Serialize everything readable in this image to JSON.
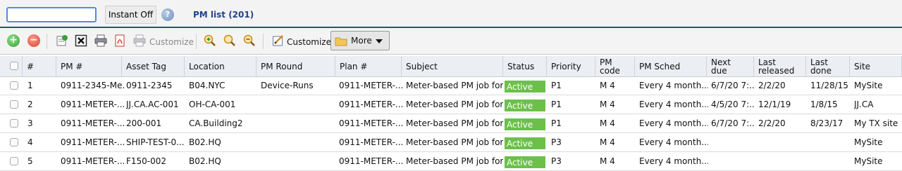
{
  "search": {
    "value": "",
    "placeholder": ""
  },
  "instant_toggle": "Instant Off",
  "help_icon": "?",
  "list_title": "PM list (201)",
  "toolbar": {
    "customize_disabled_label": "Customize",
    "customize_label": "Customize",
    "more_label": "More"
  },
  "table": {
    "headers": {
      "num": "#",
      "pm": "PM #",
      "asset": "Asset Tag",
      "location": "Location",
      "round": "PM Round",
      "plan": "Plan #",
      "subject": "Subject",
      "status": "Status",
      "priority": "Priority",
      "pmcode": "PM code",
      "sched": "PM Sched",
      "nextdue": "Next due",
      "lastrel": "Last released",
      "lastdone": "Last done",
      "site": "Site"
    },
    "rows": [
      {
        "num": "1",
        "pm": "0911-2345-Me...",
        "asset": "0911-2345",
        "location": "B04.NYC",
        "round": "Device-Runs",
        "plan": "0911-METER-...",
        "subject": "Meter-based PM job for...",
        "status": "Active",
        "priority": "P1",
        "pmcode": "M 4",
        "sched": "Every 4 month...",
        "nextdue": "6/7/20 7:...",
        "lastrel": "2/2/20",
        "lastdone": "11/28/15",
        "site": "MySite"
      },
      {
        "num": "2",
        "pm": "0911-METER-...",
        "asset": "JJ.CA.AC-001",
        "location": "OH-CA-001",
        "round": "",
        "plan": "0911-METER-...",
        "subject": "Meter-based PM job for...",
        "status": "Active",
        "priority": "P1",
        "pmcode": "M 4",
        "sched": "Every 4 month...",
        "nextdue": "4/5/20 7:...",
        "lastrel": "12/1/19",
        "lastdone": "1/8/15",
        "site": "JJ.CA"
      },
      {
        "num": "3",
        "pm": "0911-METER-...",
        "asset": "200-001",
        "location": "CA.Building2",
        "round": "",
        "plan": "0911-METER-...",
        "subject": "Meter-based PM job for...",
        "status": "Active",
        "priority": "P1",
        "pmcode": "M 4",
        "sched": "Every 4 month...",
        "nextdue": "6/7/20 7:...",
        "lastrel": "2/2/20",
        "lastdone": "8/23/17",
        "site": "My TX site"
      },
      {
        "num": "4",
        "pm": "0911-METER-...",
        "asset": "SHIP-TEST-0...",
        "location": "B02.HQ",
        "round": "",
        "plan": "0911-METER-...",
        "subject": "Meter-based PM job for...",
        "status": "Active",
        "priority": "P3",
        "pmcode": "M 4",
        "sched": "Every 4 month...",
        "nextdue": "",
        "lastrel": "",
        "lastdone": "",
        "site": "MySite"
      },
      {
        "num": "5",
        "pm": "0911-METER-...",
        "asset": "F150-002",
        "location": "B02.HQ",
        "round": "",
        "plan": "0911-METER-...",
        "subject": "Meter-based PM job for...",
        "status": "Active",
        "priority": "P3",
        "pmcode": "M 4",
        "sched": "Every 4 month...",
        "nextdue": "",
        "lastrel": "",
        "lastdone": "",
        "site": "MySite"
      }
    ]
  },
  "colors": {
    "status_active": "#6cc04a",
    "title_blue": "#23418c",
    "header_bg": "#ebeef3"
  }
}
